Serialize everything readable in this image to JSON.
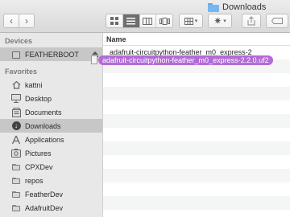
{
  "window": {
    "title": "Downloads"
  },
  "toolbar": {
    "back_icon": "‹",
    "forward_icon": "›",
    "view_modes": [
      "icon-view",
      "list-view",
      "column-view",
      "cover-flow-view"
    ],
    "active_view": "list-view"
  },
  "sidebar": {
    "devices_header": "Devices",
    "devices": [
      {
        "label": "FEATHERBOOT",
        "icon": "external-drive-icon",
        "selected": true
      }
    ],
    "favorites_header": "Favorites",
    "favorites": [
      {
        "label": "kattni",
        "icon": "home-icon"
      },
      {
        "label": "Desktop",
        "icon": "desktop-icon"
      },
      {
        "label": "Documents",
        "icon": "documents-icon"
      },
      {
        "label": "Downloads",
        "icon": "downloads-icon",
        "selected": true
      },
      {
        "label": "Applications",
        "icon": "applications-icon"
      },
      {
        "label": "Pictures",
        "icon": "pictures-icon"
      },
      {
        "label": "CPXDev",
        "icon": "folder-icon"
      },
      {
        "label": "repos",
        "icon": "folder-icon"
      },
      {
        "label": "FeatherDev",
        "icon": "folder-icon"
      },
      {
        "label": "AdafruitDev",
        "icon": "folder-icon"
      }
    ]
  },
  "main": {
    "column_name": "Name",
    "files": [
      {
        "name": "adafruit-circuitpython-feather_m0_express-2"
      }
    ]
  },
  "drag": {
    "label": "adafruit-circuitpython-feather_m0_express-2.2.0.uf2",
    "color": "#b36bd6"
  }
}
